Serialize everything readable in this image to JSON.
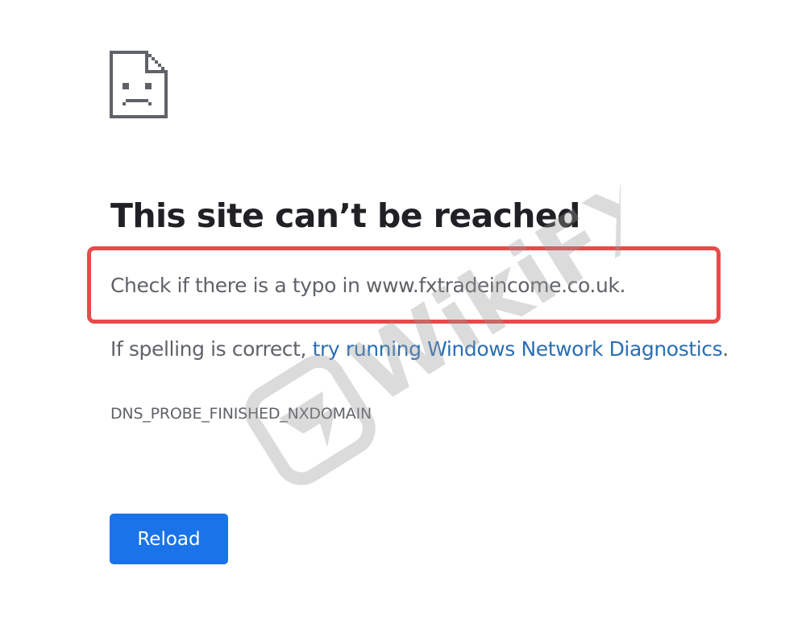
{
  "error": {
    "heading": "This site can’t be reached",
    "typo_message": "Check if there is a typo in www.fxtradeincome.co.uk.",
    "suggestion_prefix": "If spelling is correct, ",
    "suggestion_link": "try running Windows Network Diagnostics",
    "suggestion_suffix": ".",
    "code": "DNS_PROBE_FINISHED_NXDOMAIN"
  },
  "actions": {
    "reload_label": "Reload"
  },
  "watermark": {
    "text": "WikiFX"
  },
  "icons": {
    "error_page": "sad-document-icon",
    "watermark_logo": "eagle-shield-icon"
  },
  "colors": {
    "heading": "#202124",
    "body_text": "#5f6368",
    "link": "#2a6fb5",
    "button": "#1a73e8",
    "highlight": "#e54b4b",
    "watermark": "#c8c8c8"
  }
}
